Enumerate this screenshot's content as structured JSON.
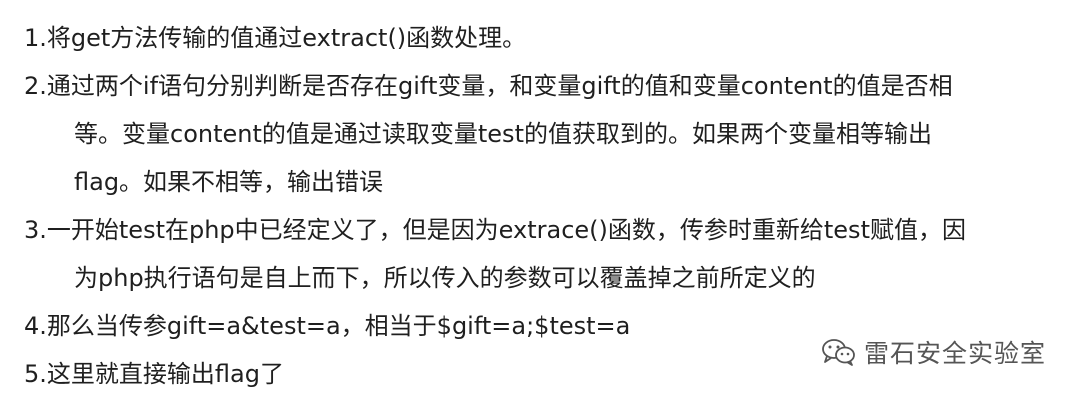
{
  "items": [
    {
      "first": "1.将get方法传输的值通过extract()函数处理。",
      "cont": []
    },
    {
      "first": "2.通过两个if语句分别判断是否存在gift变量，和变量gift的值和变量content的值是否相",
      "cont": [
        "等。变量content的值是通过读取变量test的值获取到的。如果两个变量相等输出",
        "flag。如果不相等，输出错误"
      ]
    },
    {
      "first": "3.一开始test在php中已经定义了，但是因为extrace()函数，传参时重新给test赋值，因",
      "cont": [
        "为php执行语句是自上而下，所以传入的参数可以覆盖掉之前所定义的"
      ]
    },
    {
      "first": "4.那么当传参gift=a&test=a，相当于$gift=a;$test=a",
      "cont": []
    },
    {
      "first": "5.这里就直接输出flag了",
      "cont": []
    }
  ],
  "watermark": {
    "text": "雷石安全实验室",
    "icon": "wechat-icon"
  }
}
